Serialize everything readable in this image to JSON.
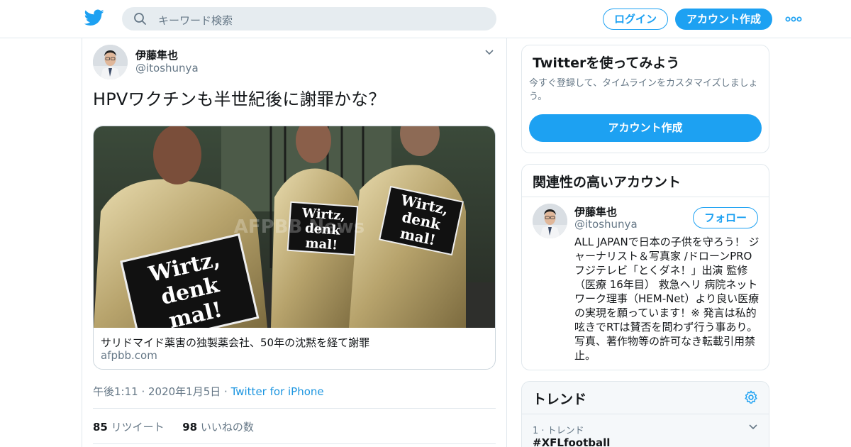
{
  "header": {
    "search_placeholder": "キーワード検索",
    "login_label": "ログイン",
    "signup_label": "アカウント作成",
    "brand_color": "#1da1f2",
    "logo_icon": "twitter-bird-icon",
    "more_icon": "more-dots-icon"
  },
  "tweet": {
    "author_name": "伊藤隼也",
    "author_handle": "@itoshunya",
    "text": "HPVワクチンも半世紀後に謝罪かな？",
    "card": {
      "title": "サリドマイド薬害の独製薬会社、50年の沈黙を経て謝罪",
      "domain": "afpbb.com",
      "image_signs": [
        "Wirtz, denk mal!",
        "Wirtz, denk mal!",
        "Wirtz, denk mal!"
      ],
      "image_signs_lines": [
        [
          "Wirtz,",
          "denk",
          "mal!"
        ]
      ],
      "watermark": "AFPBB News"
    },
    "timestamp": "午後1:11 · 2020年1月5日",
    "separator": " · ",
    "source": "Twitter for iPhone",
    "retweets_count": "85",
    "retweets_label": "リツイート",
    "likes_count": "98",
    "likes_label": "いいねの数"
  },
  "sidebar": {
    "try_title": "Twitterを使ってみよう",
    "try_sub": "今すぐ登録して、タイムラインをカスタマイズしましょう。",
    "try_button": "アカウント作成",
    "related_title": "関連性の高いアカウント",
    "related": {
      "name": "伊藤隼也",
      "handle": "@itoshunya",
      "follow_label": "フォロー",
      "bio": "ALL JAPANで日本の子供を守ろう！ ジャーナリスト＆写真家 /ドローンPRO フジテレビ「とくダネ！」出演 監修（医療 16年目） 救急ヘリ 病院ネットワーク理事（HEM-Net）より良い医療の実現を願っています！※ 発言は私的呟きでRTは賛否を問わず行う事あり。写真、著作物等の許可なき転載引用禁止。"
    },
    "trends_title": "トレンド",
    "trend": {
      "rank": "1 · トレンド",
      "name": "#XFLfootball"
    }
  }
}
